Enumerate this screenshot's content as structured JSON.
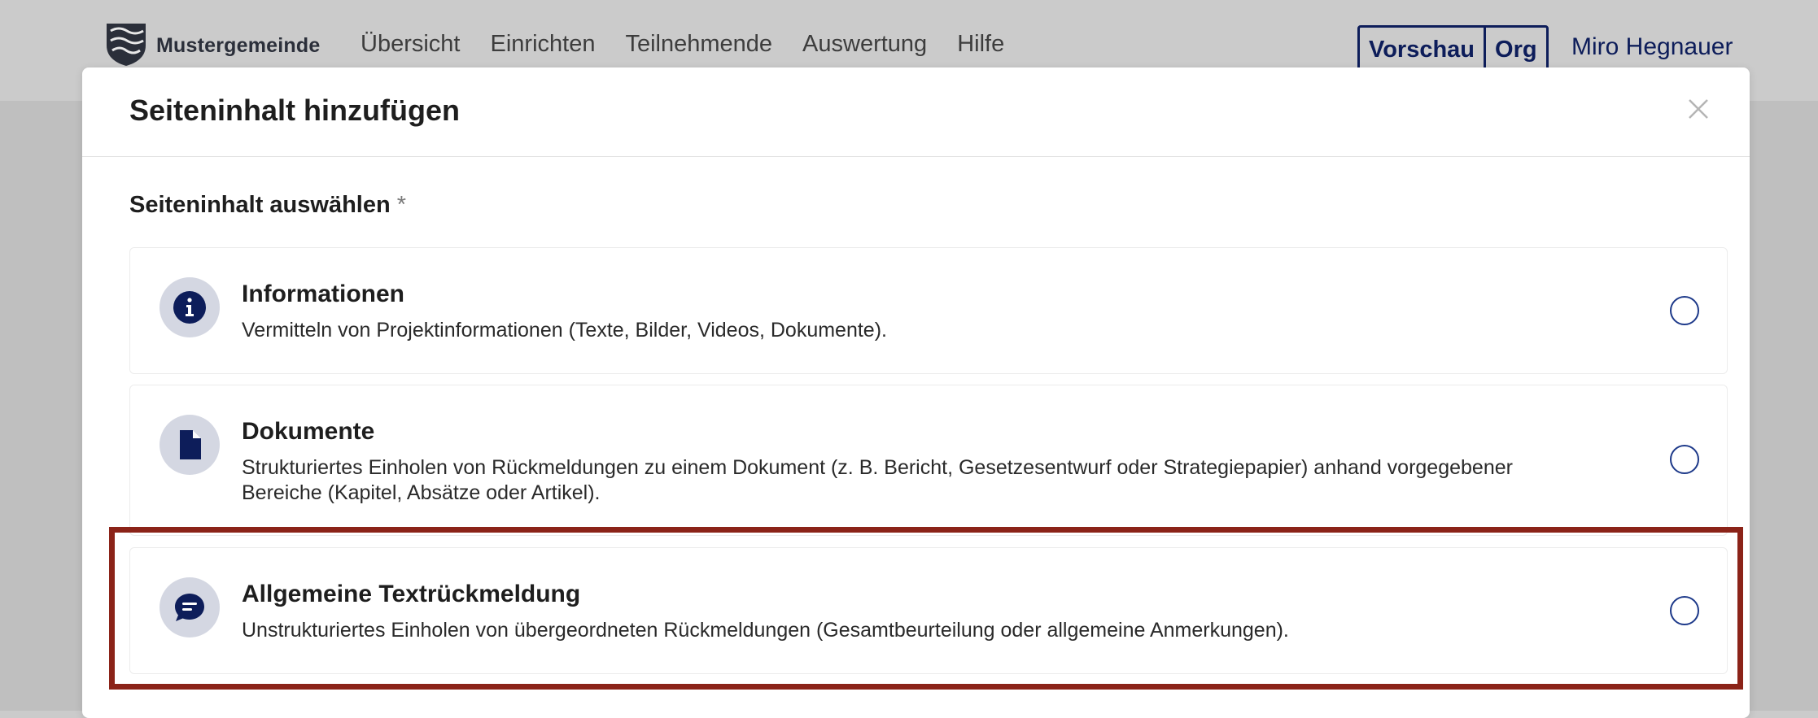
{
  "header": {
    "logo_text": "Mustergemeinde",
    "nav": [
      "Übersicht",
      "Einrichten",
      "Teilnehmende",
      "Auswertung",
      "Hilfe"
    ],
    "switch": [
      "Vorschau",
      "Org"
    ],
    "user_name": "Miro Hegnauer"
  },
  "modal": {
    "title": "Seiteninhalt hinzufügen",
    "section_label": "Seiteninhalt auswählen",
    "required_marker": "*",
    "options": [
      {
        "icon": "info-icon",
        "title": "Informationen",
        "description": "Vermitteln von Projektinformationen (Texte, Bilder, Videos, Dokumente)."
      },
      {
        "icon": "document-icon",
        "title": "Dokumente",
        "description": "Strukturiertes Einholen von Rückmeldungen zu einem Dokument (z. B. Bericht, Gesetzesentwurf oder Strategiepapier) anhand vorgegebener Bereiche (Kapitel, Absätze oder Artikel)."
      },
      {
        "icon": "chat-bubble-icon",
        "title": "Allgemeine Textrückmeldung",
        "description": "Unstrukturiertes Einholen von übergeordneten Rückmeldungen (Gesamtbeurteilung oder allgemeine Anmerkungen)."
      }
    ]
  },
  "colors": {
    "brand_navy": "#0d1d5a",
    "icon_bg": "#d4d7e2",
    "highlight": "#8b2318"
  }
}
